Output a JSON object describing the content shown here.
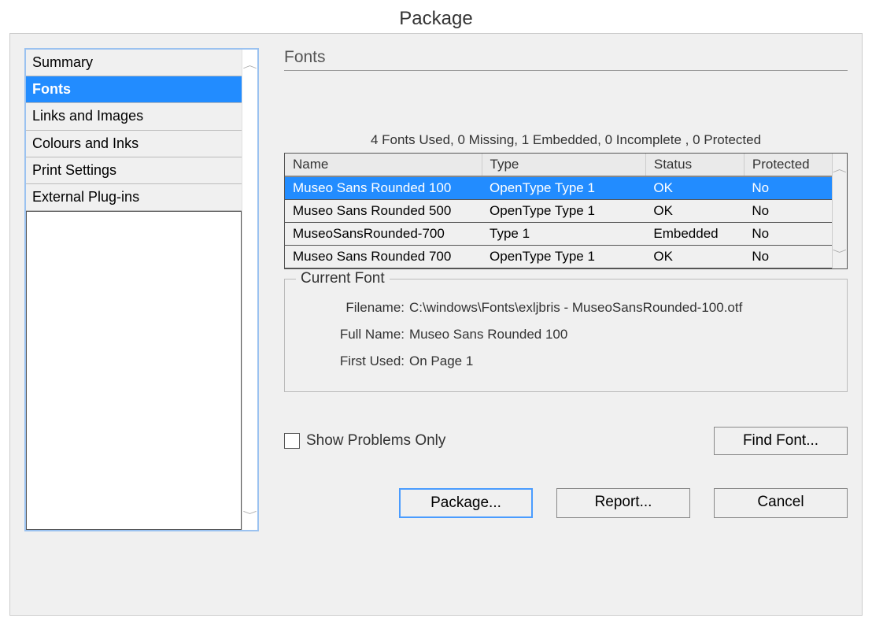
{
  "window": {
    "title": "Package"
  },
  "sidebar": {
    "items": [
      {
        "label": "Summary",
        "selected": false
      },
      {
        "label": "Fonts",
        "selected": true
      },
      {
        "label": "Links and Images",
        "selected": false
      },
      {
        "label": "Colours and Inks",
        "selected": false
      },
      {
        "label": "Print Settings",
        "selected": false
      },
      {
        "label": "External Plug-ins",
        "selected": false
      }
    ]
  },
  "main": {
    "section_title": "Fonts",
    "summary_line": "4 Fonts Used, 0 Missing, 1 Embedded, 0 Incomplete , 0 Protected",
    "table": {
      "headers": {
        "name": "Name",
        "type": "Type",
        "status": "Status",
        "protected": "Protected"
      },
      "rows": [
        {
          "name": "Museo Sans Rounded 100",
          "type": "OpenType Type 1",
          "status": "OK",
          "protected": "No",
          "selected": true
        },
        {
          "name": "Museo Sans Rounded 500",
          "type": "OpenType Type 1",
          "status": "OK",
          "protected": "No",
          "selected": false
        },
        {
          "name": "MuseoSansRounded-700",
          "type": "Type 1",
          "status": "Embedded",
          "protected": "No",
          "selected": false
        },
        {
          "name": "Museo Sans Rounded 700",
          "type": "OpenType Type 1",
          "status": "OK",
          "protected": "No",
          "selected": false
        }
      ]
    },
    "current_font": {
      "legend": "Current Font",
      "filename_label": "Filename:",
      "filename": "C:\\windows\\Fonts\\exljbris - MuseoSansRounded-100.otf",
      "fullname_label": "Full Name:",
      "fullname": "Museo Sans Rounded 100",
      "firstused_label": "First Used:",
      "firstused": "On Page 1"
    },
    "show_problems_label": "Show Problems Only",
    "find_font_label": "Find Font..."
  },
  "buttons": {
    "package": "Package...",
    "report": "Report...",
    "cancel": "Cancel"
  }
}
